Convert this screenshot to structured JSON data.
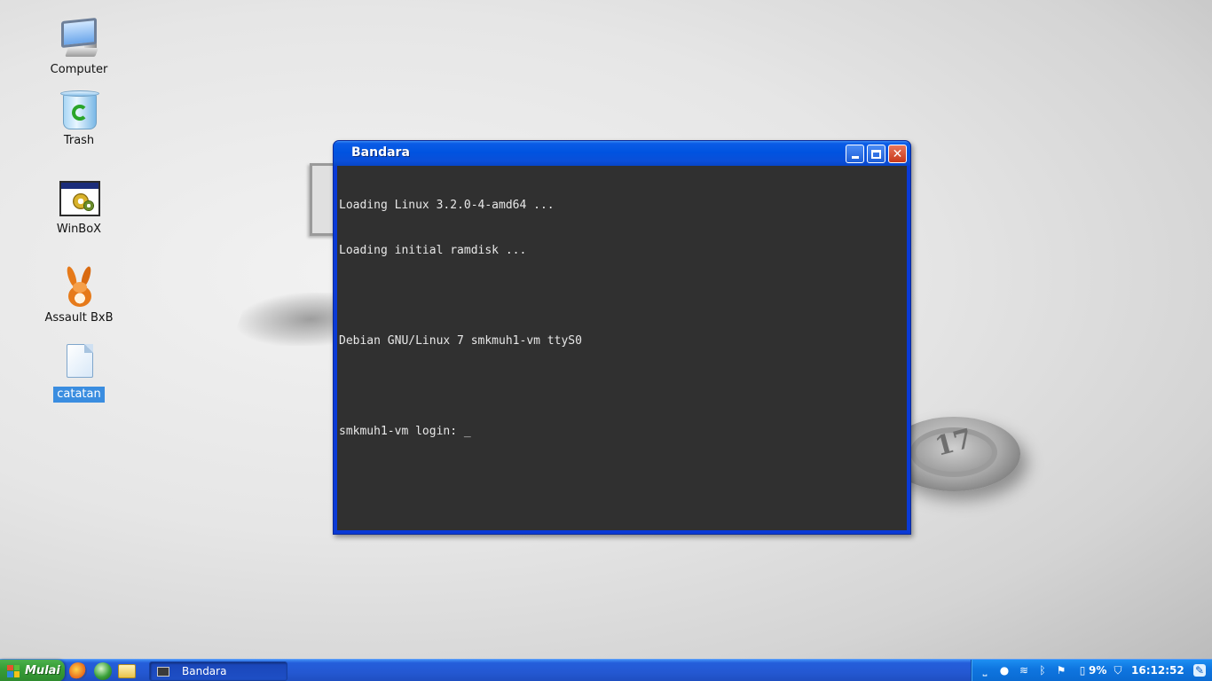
{
  "wallpaper": {
    "badge_text": "17"
  },
  "desktop": {
    "icons": [
      {
        "label": "Computer",
        "icon": "computer-icon"
      },
      {
        "label": "Trash",
        "icon": "trash-icon"
      },
      {
        "label": "WinBoX",
        "icon": "winbox-icon"
      },
      {
        "label": "Assault BxB",
        "icon": "assault-icon"
      },
      {
        "label": "catatan",
        "icon": "document-icon",
        "selected": true
      }
    ]
  },
  "window": {
    "title": "Bandara",
    "terminal_lines": [
      "Loading Linux 3.2.0-4-amd64 ...",
      "Loading initial ramdisk ...",
      "",
      "Debian GNU/Linux 7 smkmuh1-vm ttyS0",
      "",
      "smkmuh1-vm login: _"
    ]
  },
  "taskbar": {
    "start_label": "Mulai",
    "quick_launch": [
      "firefox-icon",
      "globe-icon",
      "folder-icon"
    ],
    "tasks": [
      {
        "label": "Bandara"
      }
    ],
    "tray": {
      "battery": "9%",
      "clock": "16:12:52"
    }
  },
  "colors": {
    "titlebar": "#0053e0",
    "terminal_bg": "#303030",
    "start_button": "#379e37",
    "taskbar": "#245edb",
    "selection": "#3a8de0"
  }
}
